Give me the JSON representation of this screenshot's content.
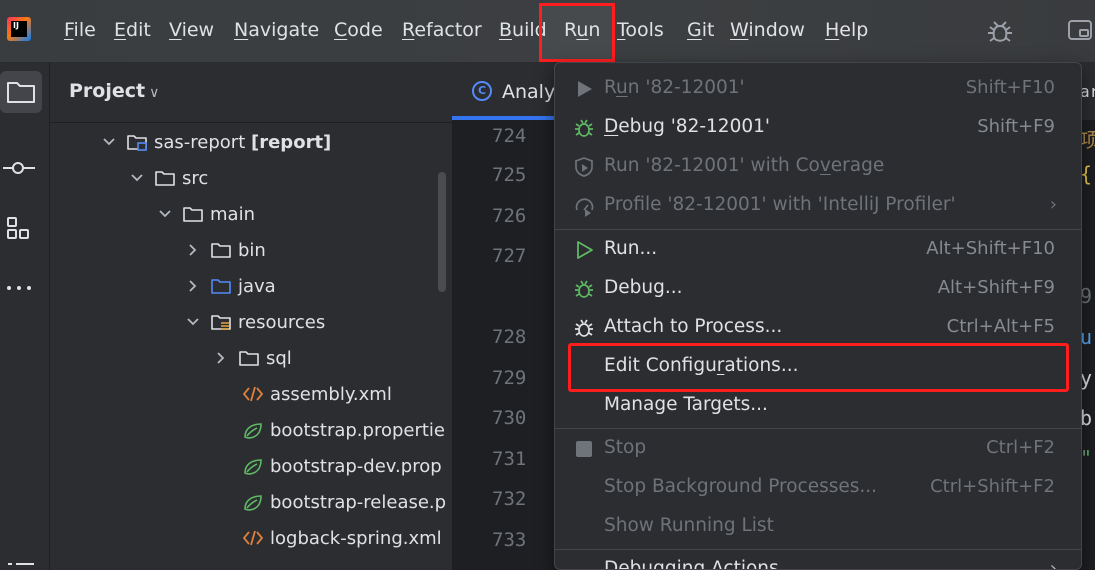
{
  "menubar": {
    "logo_text": "IJ",
    "items": [
      {
        "pre": "",
        "u": "F",
        "post": "ile"
      },
      {
        "pre": "",
        "u": "E",
        "post": "dit"
      },
      {
        "pre": "",
        "u": "V",
        "post": "iew"
      },
      {
        "pre": "",
        "u": "N",
        "post": "avigate"
      },
      {
        "pre": "",
        "u": "C",
        "post": "ode"
      },
      {
        "pre": "",
        "u": "R",
        "post": "efactor"
      },
      {
        "pre": "",
        "u": "B",
        "post": "uild"
      },
      {
        "pre": "R",
        "u": "u",
        "post": "n"
      },
      {
        "pre": "",
        "u": "T",
        "post": "ools"
      },
      {
        "pre": "",
        "u": "G",
        "post": "it"
      },
      {
        "pre": "",
        "u": "W",
        "post": "indow"
      },
      {
        "pre": "",
        "u": "H",
        "post": "elp"
      }
    ],
    "highlight_color": "#ff1e1e"
  },
  "toolstrip": {
    "icons": [
      "folder-icon",
      "commit-icon",
      "structure-icon",
      "more-icon"
    ]
  },
  "project": {
    "title": "Project",
    "tree": [
      {
        "name": "sas-report",
        "suffix": "[report]",
        "kind": "module"
      },
      {
        "name": "src",
        "suffix": "",
        "kind": "folder"
      },
      {
        "name": "main",
        "suffix": "",
        "kind": "folder"
      },
      {
        "name": "bin",
        "suffix": "",
        "kind": "folder"
      },
      {
        "name": "java",
        "suffix": "",
        "kind": "source-folder"
      },
      {
        "name": "resources",
        "suffix": "",
        "kind": "resource-folder"
      },
      {
        "name": "sql",
        "suffix": "",
        "kind": "folder"
      },
      {
        "name": "assembly.xml",
        "suffix": "",
        "kind": "xml"
      },
      {
        "name": "bootstrap.propertie",
        "suffix": "",
        "kind": "properties"
      },
      {
        "name": "bootstrap-dev.prop",
        "suffix": "",
        "kind": "properties"
      },
      {
        "name": "bootstrap-release.p",
        "suffix": "",
        "kind": "properties"
      },
      {
        "name": "logback-spring.xml",
        "suffix": "",
        "kind": "xml"
      }
    ]
  },
  "editor": {
    "tab_icon": "C",
    "tab_label": "Analy",
    "line_numbers": [
      "724",
      "725",
      "726",
      "727",
      "728",
      "729",
      "730",
      "731",
      "732",
      "733"
    ],
    "right_fragments": [
      "ar",
      "项",
      "{",
      "9",
      "u",
      "y",
      "b",
      "\""
    ]
  },
  "run_menu": {
    "items": [
      {
        "pre": "R",
        "u": "u",
        "post": "n '82-12001'",
        "shortcut": "Shift+F10",
        "disabled": true,
        "icon": "run-icon"
      },
      {
        "pre": "",
        "u": "D",
        "post": "ebug '82-12001'",
        "shortcut": "Shift+F9",
        "disabled": false,
        "icon": "debug-icon"
      },
      {
        "pre": "Run '82-12001' with Co",
        "u": "v",
        "post": "erage",
        "shortcut": "",
        "disabled": true,
        "icon": "coverage-icon"
      },
      {
        "pre": "Profile '82-12001' with 'IntelliJ Profiler'",
        "u": "",
        "post": "",
        "shortcut": "",
        "disabled": true,
        "icon": "profiler-icon",
        "submenu": true
      },
      {
        "pre": "Run...",
        "u": "",
        "post": "",
        "shortcut": "Alt+Shift+F10",
        "disabled": false,
        "icon": "run-outline-icon"
      },
      {
        "pre": "Debug...",
        "u": "",
        "post": "",
        "shortcut": "Alt+Shift+F9",
        "disabled": false,
        "icon": "debug-icon"
      },
      {
        "pre": "Attach to Process...",
        "u": "",
        "post": "",
        "shortcut": "Ctrl+Alt+F5",
        "disabled": false,
        "icon": "attach-icon"
      },
      {
        "pre": "Edit Configu",
        "u": "r",
        "post": "ations...",
        "shortcut": "",
        "disabled": false,
        "icon": ""
      },
      {
        "pre": "Manage Targets...",
        "u": "",
        "post": "",
        "shortcut": "",
        "disabled": false,
        "icon": ""
      },
      {
        "pre": "Stop",
        "u": "",
        "post": "",
        "shortcut": "Ctrl+F2",
        "disabled": true,
        "icon": "stop-icon"
      },
      {
        "pre": "Stop Background Processes...",
        "u": "",
        "post": "",
        "shortcut": "Ctrl+Shift+F2",
        "disabled": true,
        "icon": ""
      },
      {
        "pre": "Show Running List",
        "u": "",
        "post": "",
        "shortcut": "",
        "disabled": true,
        "icon": ""
      },
      {
        "pre": "Debugging Actions",
        "u": "",
        "post": "",
        "shortcut": "",
        "disabled": false,
        "icon": "",
        "submenu": true
      }
    ]
  },
  "colors": {
    "accent": "#3574f0",
    "run_green": "#5fb865",
    "highlight_red": "#ff1e1e"
  }
}
